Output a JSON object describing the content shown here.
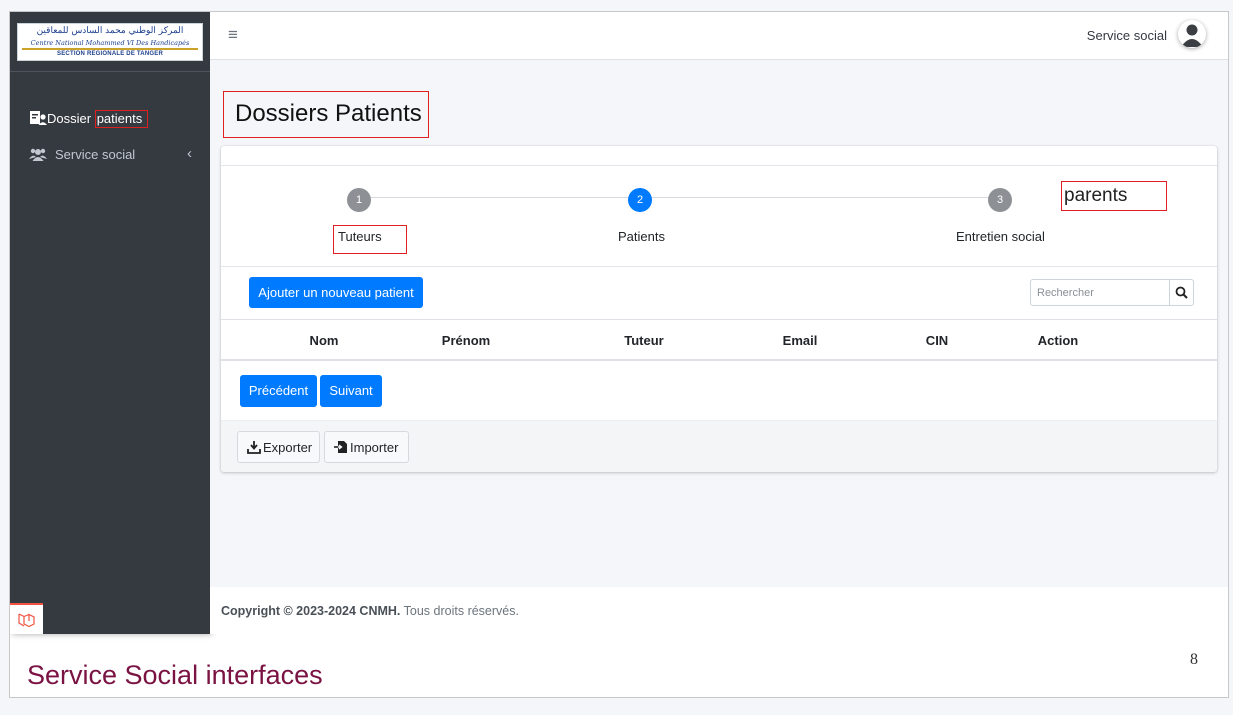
{
  "logo": {
    "arabic": "المركز الوطني محمد السادس للمعاقين",
    "french": "Centre National Mohammed VI Des Handicapés",
    "section": "SECTION REGIONALE DE TANGER"
  },
  "sidebar": {
    "items": [
      {
        "label_a": "Dossier ",
        "label_b": "patients",
        "icon": "patient-file-icon"
      },
      {
        "label": "Service social",
        "icon": "users-icon"
      }
    ]
  },
  "header": {
    "user_name": "Service social"
  },
  "page": {
    "title": "Dossiers Patients"
  },
  "stepper": {
    "steps": [
      {
        "number": "1",
        "label": "Tuteurs",
        "state": "done"
      },
      {
        "number": "2",
        "label": "Patients",
        "state": "active"
      },
      {
        "number": "3",
        "label": "Entretien social",
        "state": "pending"
      }
    ],
    "annotation": "parents"
  },
  "toolbar": {
    "add_label": "Ajouter un nouveau patient",
    "search_placeholder": "Rechercher"
  },
  "table": {
    "columns": [
      "Nom",
      "Prénom",
      "Tuteur",
      "Email",
      "CIN",
      "Action"
    ],
    "rows": []
  },
  "pagination": {
    "prev": "Précédent",
    "next": "Suivant"
  },
  "card_footer": {
    "export": "Exporter",
    "import": "Importer"
  },
  "footer": {
    "copyright_bold": "Copyright © 2023-2024 CNMH.",
    "copyright_rest": " Tous droits réservés."
  },
  "slide": {
    "title": "Service Social interfaces",
    "number": "8"
  },
  "colors": {
    "primary": "#007bff",
    "sidebar": "#343a40",
    "highlight": "#e02020",
    "slide_title": "#7a1242"
  }
}
